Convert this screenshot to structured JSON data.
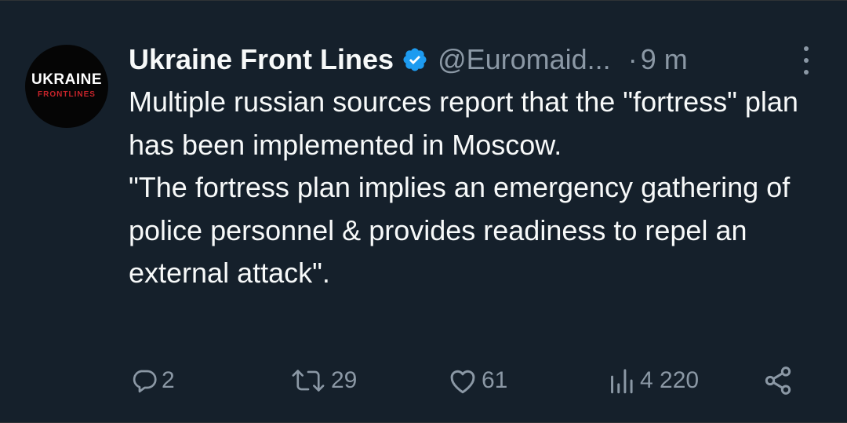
{
  "tweet": {
    "avatar": {
      "line1": "UKRAINE",
      "line2": "FRONTLINES"
    },
    "author": {
      "name": "Ukraine Front Lines",
      "handle": "@Euromaid...",
      "separator": "·",
      "time": "9 m",
      "verified_icon": "verified-badge-icon",
      "verified_color": "#1d9bf0"
    },
    "text": {
      "paragraph1": "Multiple russian sources report that the \"fortress\" plan has been implemented in Moscow.",
      "paragraph2": "\"The fortress plan implies an emergency gathering of police personnel & provides readiness to repel an external attack\"."
    },
    "actions": {
      "replies": "2",
      "retweets": "29",
      "likes": "61",
      "views": "4 220"
    }
  },
  "colors": {
    "background": "#15202b",
    "text": "#f7f9f9",
    "secondary": "#8b98a5",
    "avatar_accent": "#c8242b"
  }
}
